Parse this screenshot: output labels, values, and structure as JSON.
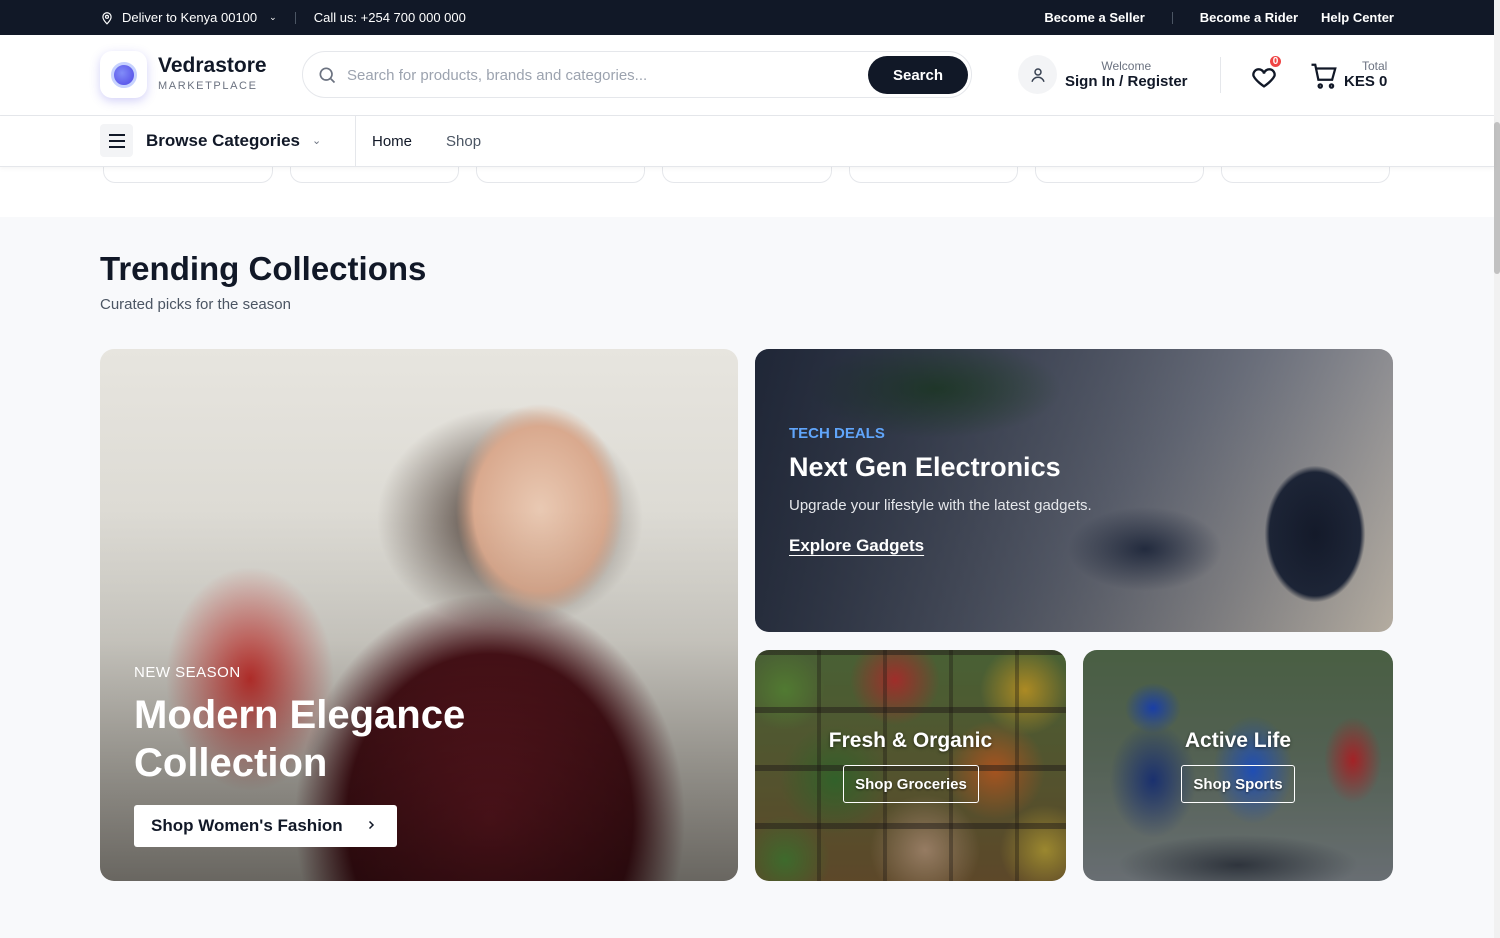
{
  "topbar": {
    "location_icon": "map-pin-icon",
    "deliver": "Deliver to Kenya 00100",
    "call": "Call us: +254 700 000 000",
    "links": [
      "Become a Seller",
      "Become a Rider",
      "Help Center"
    ]
  },
  "header": {
    "brand": "Vedrastore",
    "brand_sub": "MARKETPLACE",
    "search_placeholder": "Search for products, brands and categories...",
    "search_button": "Search",
    "welcome": "Welcome",
    "account_link": "Sign In / Register",
    "wishlist_count": "0",
    "cart_label": "Total",
    "cart_total": "KES 0"
  },
  "nav": {
    "categories": "Browse Categories",
    "links": [
      "Home",
      "Shop"
    ]
  },
  "section": {
    "title": "Trending Collections",
    "subtitle": "Curated picks for the season"
  },
  "cards": {
    "fashion": {
      "tag": "NEW SEASON",
      "title": "Modern Elegance Collection",
      "button": "Shop Women's Fashion"
    },
    "electronics": {
      "tag": "TECH DEALS",
      "title": "Next Gen Electronics",
      "subtitle": "Upgrade your lifestyle with the latest gadgets.",
      "link": "Explore Gadgets"
    },
    "groceries": {
      "title": "Fresh & Organic",
      "button": "Shop Groceries"
    },
    "sports": {
      "title": "Active Life",
      "button": "Shop Sports"
    }
  },
  "colors": {
    "dark": "#111827",
    "accent_blue": "#60a5fa",
    "badge_red": "#ef4444",
    "brand_purple": "#4f46e5"
  }
}
